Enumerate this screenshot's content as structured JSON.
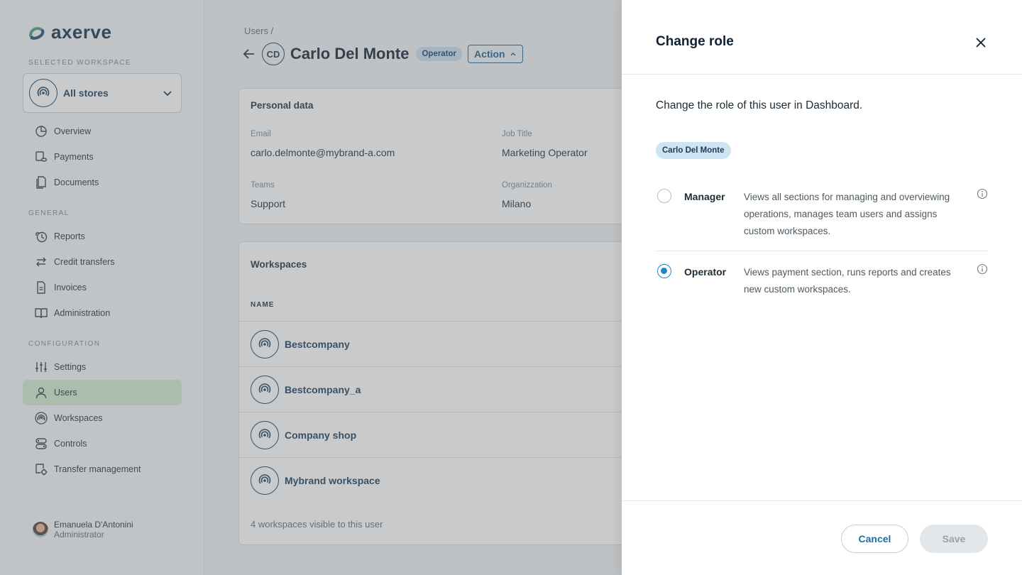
{
  "brand": {
    "name": "axerve"
  },
  "sidebar": {
    "selected_workspace_label": "SELECTED WORKSPACE",
    "workspace_select": {
      "value": "All stores"
    },
    "items_main": [
      {
        "label": "Overview",
        "icon": "pie-chart-icon"
      },
      {
        "label": "Payments",
        "icon": "payments-icon"
      },
      {
        "label": "Documents",
        "icon": "documents-icon"
      }
    ],
    "general_label": "GENERAL",
    "items_general": [
      {
        "label": "Reports",
        "icon": "reports-icon"
      },
      {
        "label": "Credit transfers",
        "icon": "transfer-arrows-icon"
      },
      {
        "label": "Invoices",
        "icon": "invoice-icon"
      },
      {
        "label": "Administration",
        "icon": "book-icon"
      }
    ],
    "configuration_label": "CONFIGURATION",
    "items_config": [
      {
        "label": "Settings",
        "icon": "sliders-icon"
      },
      {
        "label": "Users",
        "icon": "user-icon",
        "active": true
      },
      {
        "label": "Workspaces",
        "icon": "workspace-icon"
      },
      {
        "label": "Controls",
        "icon": "controls-icon"
      },
      {
        "label": "Transfer management",
        "icon": "transfer-settings-icon"
      }
    ],
    "user": {
      "name": "Emanuela D'Antonini",
      "role": "Administrator"
    }
  },
  "main": {
    "breadcrumb": "Users /",
    "initials": "CD",
    "title": "Carlo Del Monte",
    "role_badge": "Operator",
    "action_label": "Action",
    "personal": {
      "title": "Personal data",
      "email_label": "Email",
      "email": "carlo.delmonte@mybrand-a.com",
      "job_label": "Job Title",
      "job": "Marketing Operator",
      "teams_label": "Teams",
      "teams": "Support",
      "org_label": "Organizzation",
      "org": "Milano"
    },
    "workspaces": {
      "title": "Workspaces",
      "column_name": "NAME",
      "rows": [
        "Bestcompany",
        "Bestcompany_a",
        "Company shop",
        "Mybrand workspace"
      ],
      "footer": "4 workspaces visible to this user"
    }
  },
  "drawer": {
    "title": "Change role",
    "intro": "Change the role of this user in Dashboard.",
    "user_chip": "Carlo Del Monte",
    "roles": [
      {
        "name": "Manager",
        "description": "Views all sections for managing and overviewing operations, manages team users and assigns custom workspaces.",
        "selected": false
      },
      {
        "name": "Operator",
        "description": "Views payment section, runs reports and creates new custom workspaces.",
        "selected": true
      }
    ],
    "cancel_label": "Cancel",
    "save_label": "Save"
  },
  "colors": {
    "brand_green": "#3aa17e",
    "brand_navy": "#10304a",
    "accent_blue": "#1c88c9",
    "active_nav": "#d2e8ce"
  }
}
